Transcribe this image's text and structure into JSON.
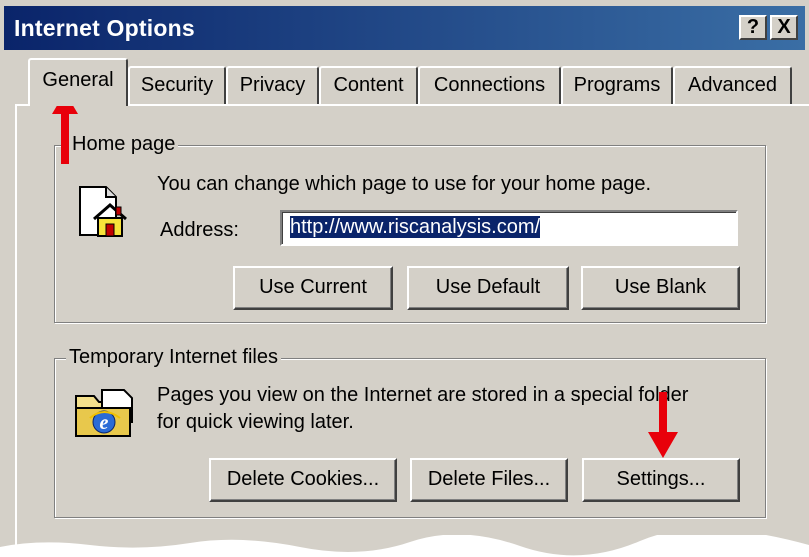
{
  "window": {
    "title": "Internet Options",
    "help_button": "?",
    "close_button": "X"
  },
  "tabs": [
    {
      "label": "General",
      "active": true
    },
    {
      "label": "Security",
      "active": false
    },
    {
      "label": "Privacy",
      "active": false
    },
    {
      "label": "Content",
      "active": false
    },
    {
      "label": "Connections",
      "active": false
    },
    {
      "label": "Programs",
      "active": false
    },
    {
      "label": "Advanced",
      "active": false
    }
  ],
  "home_page": {
    "legend": "Home page",
    "description": "You can change which page to use for your home page.",
    "address_label": "Address:",
    "address_value": "http://www.riscanalysis.com/",
    "buttons": {
      "use_current": "Use Current",
      "use_default": "Use Default",
      "use_blank": "Use Blank"
    }
  },
  "temp_files": {
    "legend": "Temporary Internet files",
    "description_line1": "Pages you view on the Internet are stored in a special folder",
    "description_line2": "for quick viewing later.",
    "buttons": {
      "delete_cookies": "Delete Cookies...",
      "delete_files": "Delete Files...",
      "settings": "Settings..."
    }
  },
  "colors": {
    "titlebar_start": "#0a246a",
    "titlebar_end": "#3a6ea5",
    "dialog_face": "#d4d0c8",
    "annotation_arrow": "#e8000a"
  },
  "icons": [
    "home-page-icon",
    "temp-files-folder-icon",
    "annotation-arrow-up",
    "annotation-arrow-down"
  ]
}
